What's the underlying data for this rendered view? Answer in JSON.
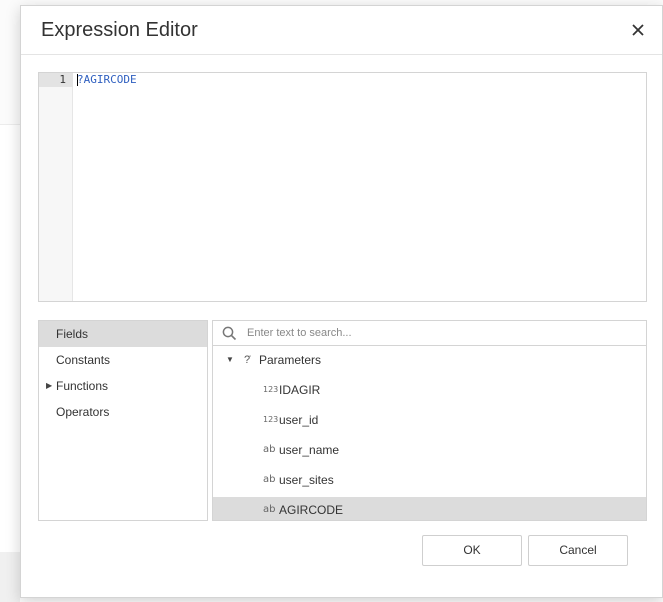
{
  "dialog": {
    "title": "Expression Editor",
    "close_icon": "close-icon"
  },
  "editor": {
    "line_number": "1",
    "code": "?AGIRCODE"
  },
  "categories": [
    {
      "label": "Fields",
      "selected": true,
      "expandable": false
    },
    {
      "label": "Constants",
      "selected": false,
      "expandable": false
    },
    {
      "label": "Functions",
      "selected": false,
      "expandable": true
    },
    {
      "label": "Operators",
      "selected": false,
      "expandable": false
    }
  ],
  "search": {
    "placeholder": "Enter text to search...",
    "icon": "search-icon"
  },
  "tree": {
    "parent_label": "Parameters",
    "items": [
      {
        "type_icon": "123",
        "label": "IDAGIR"
      },
      {
        "type_icon": "123",
        "label": "user_id"
      },
      {
        "type_icon": "ab",
        "label": "user_name"
      },
      {
        "type_icon": "ab",
        "label": "user_sites"
      },
      {
        "type_icon": "ab",
        "label": "AGIRCODE"
      }
    ]
  },
  "buttons": {
    "ok": "OK",
    "cancel": "Cancel"
  },
  "colors": {
    "selected_bg": "#dcdcdc",
    "code_text": "#3060c0"
  }
}
